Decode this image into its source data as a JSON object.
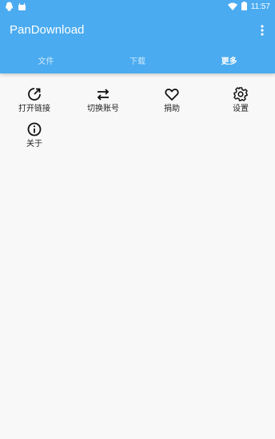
{
  "status_bar": {
    "time": "11:57",
    "left_icons": [
      "qq-icon",
      "android-icon"
    ],
    "right_icons": [
      "wifi-icon",
      "battery-icon"
    ]
  },
  "toolbar": {
    "title": "PanDownload",
    "overflow_icon": "more-vertical-icon"
  },
  "tabs": [
    {
      "label": "文件",
      "active": false
    },
    {
      "label": "下载",
      "active": false
    },
    {
      "label": "更多",
      "active": true
    }
  ],
  "menu": [
    {
      "label": "打开链接",
      "icon": "open-link-icon"
    },
    {
      "label": "切换账号",
      "icon": "switch-account-icon"
    },
    {
      "label": "捐助",
      "icon": "heart-icon"
    },
    {
      "label": "设置",
      "icon": "gear-icon"
    },
    {
      "label": "关于",
      "icon": "info-icon"
    }
  ],
  "colors": {
    "primary": "#4aabf0",
    "background": "#f8f8f8",
    "text": "#222222"
  }
}
